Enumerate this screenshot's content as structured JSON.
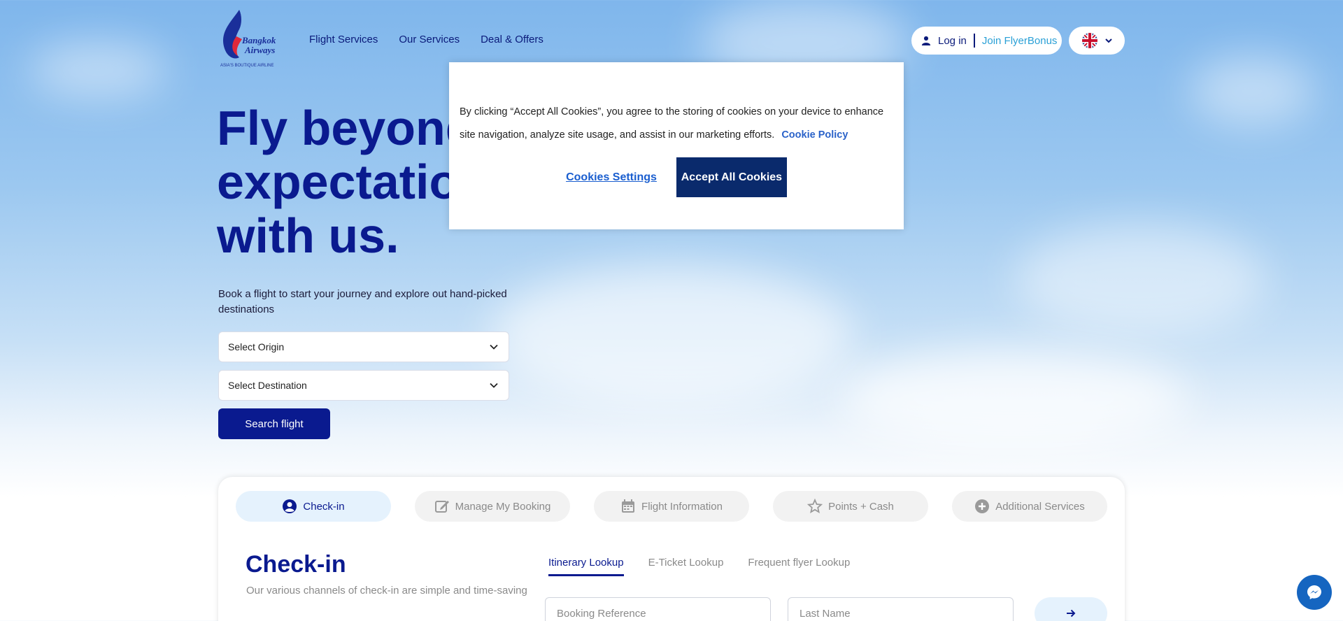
{
  "brand": {
    "logo_line1": "Bangkok",
    "logo_line2": "Airways",
    "tagline": "ASIA'S BOUTIQUE AIRLINE",
    "primary_color": "#0a1a8f",
    "accent_color": "#2aa0d6"
  },
  "nav": {
    "items": [
      "Flight Services",
      "Our Services",
      "Deal & Offers"
    ]
  },
  "account": {
    "login_label": "Log in",
    "join_label": "Join FlyerBonus",
    "user_icon": "user-icon",
    "language_icon": "uk-flag-icon"
  },
  "hero": {
    "title_lines": [
      "Fly beyond",
      "expectations",
      "with us."
    ],
    "subtitle": "Book a flight to start your journey and explore out hand-picked destinations",
    "origin_value": "Select Origin",
    "destination_value": "Select Destination",
    "search_label": "Search flight"
  },
  "services": {
    "tabs": [
      {
        "label": "Check-in",
        "icon": "user-circle-icon"
      },
      {
        "label": "Manage My Booking",
        "icon": "edit-icon"
      },
      {
        "label": "Flight Information",
        "icon": "calendar-icon"
      },
      {
        "label": "Points + Cash",
        "icon": "star-icon"
      },
      {
        "label": "Additional Services",
        "icon": "plus-circle-icon"
      }
    ],
    "checkin_title": "Check-in",
    "checkin_subtitle": "Our various channels of check-in are simple and time-saving",
    "subtabs": [
      "Itinerary Lookup",
      "E-Ticket Lookup",
      "Frequent flyer Lookup"
    ],
    "booking_placeholder": "Booking Reference",
    "lastname_placeholder": "Last Name"
  },
  "cookie": {
    "message": "By clicking “Accept All Cookies”, you agree to the storing of cookies on your device to enhance site navigation, analyze site usage, and assist in our marketing efforts.",
    "policy_label": "Cookie Policy",
    "settings_label": "Cookies Settings",
    "accept_label": "Accept All Cookies"
  }
}
